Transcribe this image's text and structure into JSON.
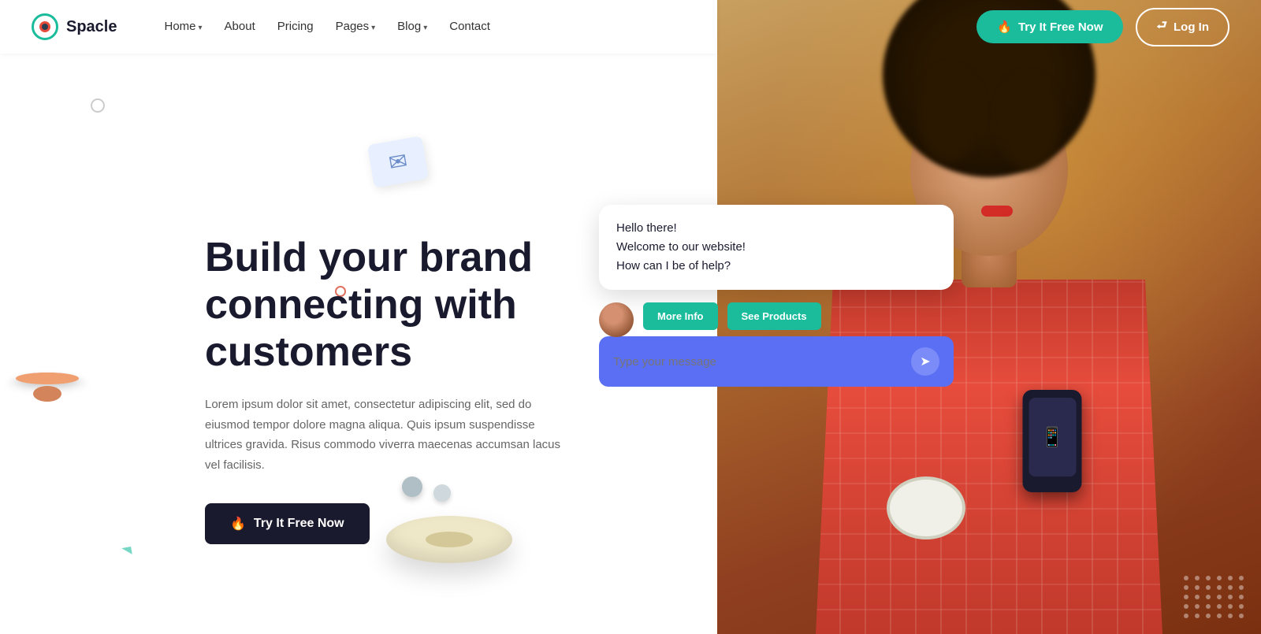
{
  "brand": {
    "name": "Spacle"
  },
  "nav": {
    "links": [
      {
        "label": "Home",
        "has_arrow": true
      },
      {
        "label": "About",
        "has_arrow": false
      },
      {
        "label": "Pricing",
        "has_arrow": false
      },
      {
        "label": "Pages",
        "has_arrow": true
      },
      {
        "label": "Blog",
        "has_arrow": true
      },
      {
        "label": "Contact",
        "has_arrow": false
      }
    ]
  },
  "header_buttons": {
    "try_free": "Try It Free Now",
    "login": "Log In"
  },
  "hero": {
    "title": "Build your brand connecting with customers",
    "description": "Lorem ipsum dolor sit amet, consectetur adipiscing elit, sed do eiusmod tempor dolore magna aliqua. Quis ipsum suspendisse ultrices gravida. Risus commodo viverra maecenas accumsan lacus vel facilisis.",
    "cta_label": "Try It Free Now"
  },
  "chat": {
    "bubble_text_line1": "Hello there!",
    "bubble_text_line2": "Welcome to our website!",
    "bubble_text_line3": "How can I be of help?",
    "btn_more_info": "More Info",
    "btn_see_products": "See Products",
    "input_placeholder": "Type your message"
  },
  "colors": {
    "teal": "#1abc9c",
    "dark": "#1a1a2e",
    "purple_input": "#5b6ff5"
  }
}
